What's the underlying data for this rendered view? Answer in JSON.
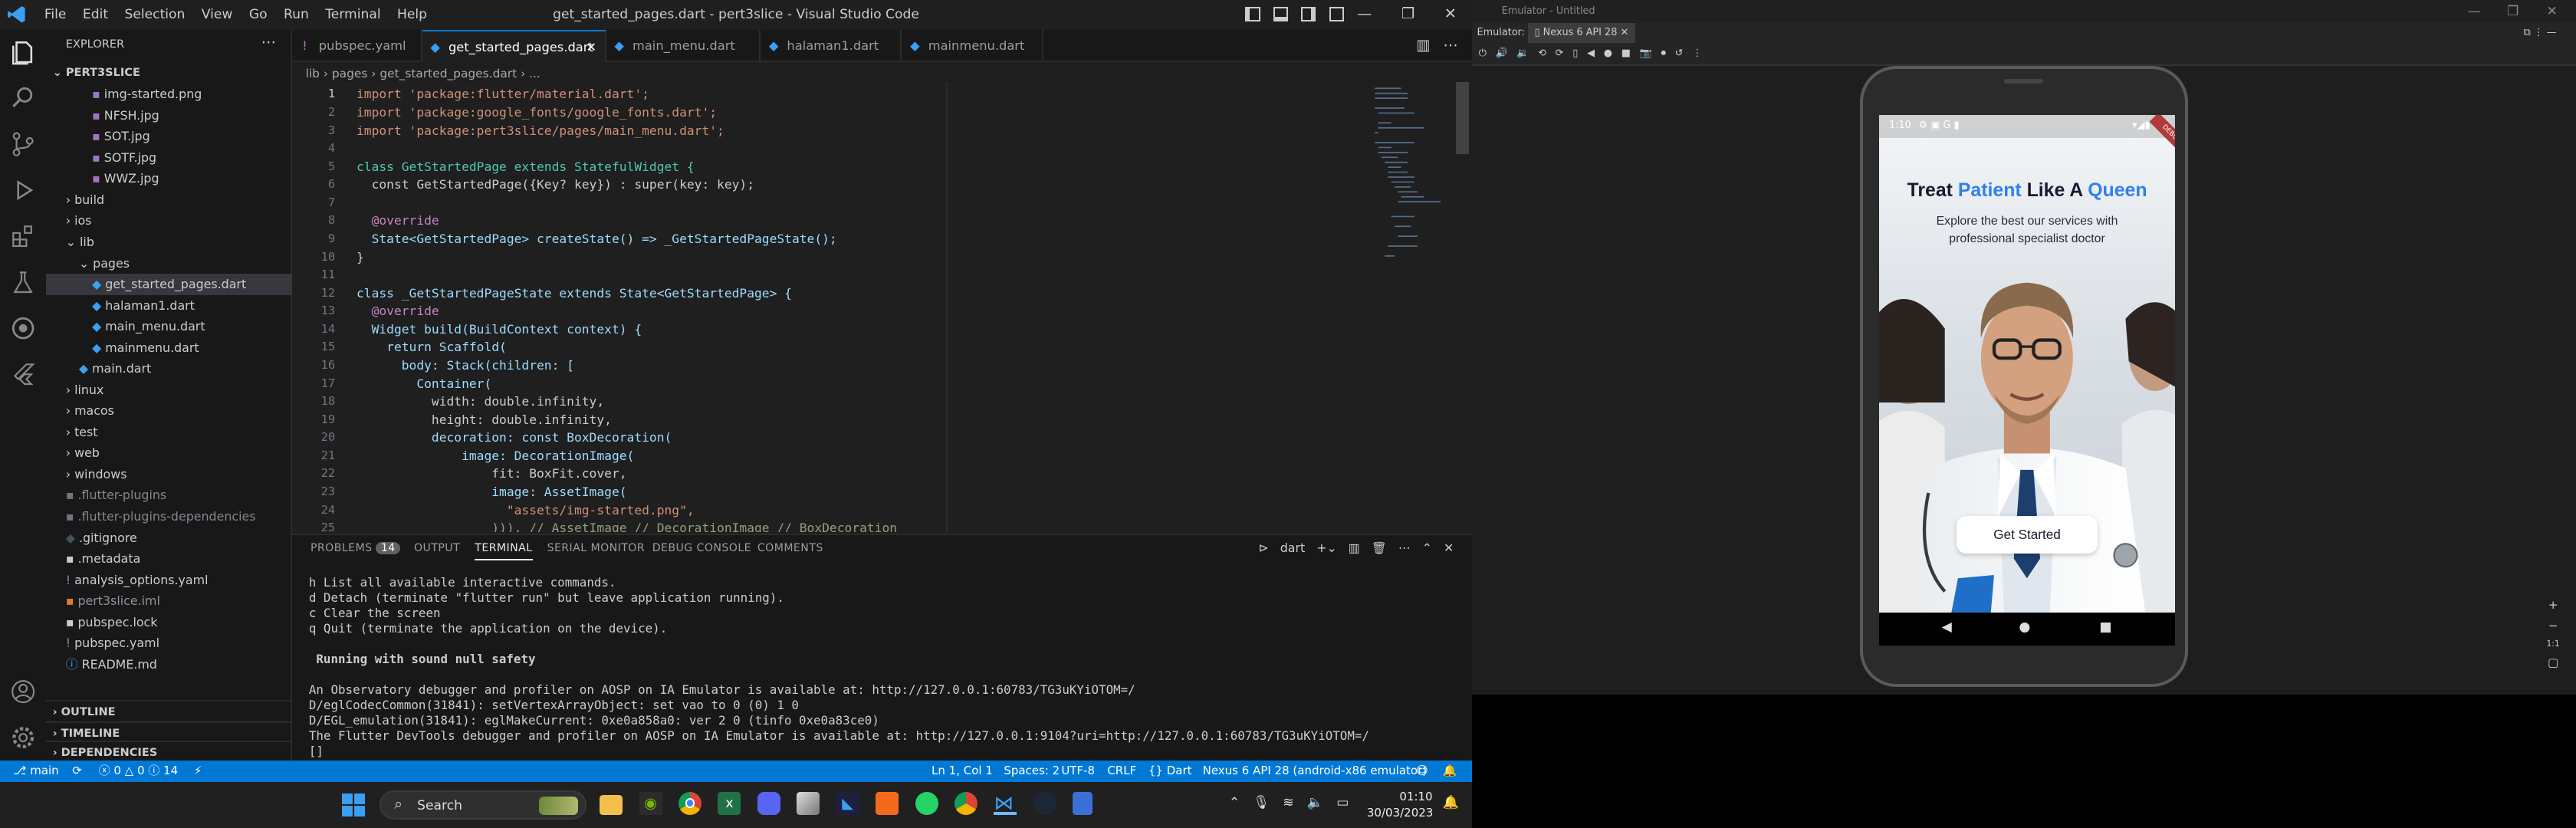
{
  "window": {
    "title": "get_started_pages.dart - pert3slice - Visual Studio Code"
  },
  "menu": [
    "File",
    "Edit",
    "Selection",
    "View",
    "Go",
    "Run",
    "Terminal",
    "Help"
  ],
  "explorer": {
    "header": "EXPLORER",
    "project": "PERT3SLICE",
    "items": [
      {
        "label": "img-started.png",
        "indent": 3,
        "kind": "png"
      },
      {
        "label": "NFSH.jpg",
        "indent": 3,
        "kind": "jpg"
      },
      {
        "label": "SOT.jpg",
        "indent": 3,
        "kind": "jpg"
      },
      {
        "label": "SOTF.jpg",
        "indent": 3,
        "kind": "jpg"
      },
      {
        "label": "WWZ.jpg",
        "indent": 3,
        "kind": "jpg"
      },
      {
        "label": "build",
        "indent": 1,
        "kind": "folder-closed"
      },
      {
        "label": "ios",
        "indent": 1,
        "kind": "folder-closed"
      },
      {
        "label": "lib",
        "indent": 1,
        "kind": "folder-open"
      },
      {
        "label": "pages",
        "indent": 2,
        "kind": "folder-open"
      },
      {
        "label": "get_started_pages.dart",
        "indent": 3,
        "kind": "dart",
        "selected": true
      },
      {
        "label": "halaman1.dart",
        "indent": 3,
        "kind": "dart"
      },
      {
        "label": "main_menu.dart",
        "indent": 3,
        "kind": "dart"
      },
      {
        "label": "mainmenu.dart",
        "indent": 3,
        "kind": "dart"
      },
      {
        "label": "main.dart",
        "indent": 2,
        "kind": "dart"
      },
      {
        "label": "linux",
        "indent": 1,
        "kind": "folder-closed"
      },
      {
        "label": "macos",
        "indent": 1,
        "kind": "folder-closed"
      },
      {
        "label": "test",
        "indent": 1,
        "kind": "folder-closed"
      },
      {
        "label": "web",
        "indent": 1,
        "kind": "folder-closed"
      },
      {
        "label": "windows",
        "indent": 1,
        "kind": "folder-closed"
      },
      {
        "label": ".flutter-plugins",
        "indent": 1,
        "kind": "dim"
      },
      {
        "label": ".flutter-plugins-dependencies",
        "indent": 1,
        "kind": "dim"
      },
      {
        "label": ".gitignore",
        "indent": 1,
        "kind": "git"
      },
      {
        "label": ".metadata",
        "indent": 1,
        "kind": "meta"
      },
      {
        "label": "analysis_options.yaml",
        "indent": 1,
        "kind": "yaml"
      },
      {
        "label": "pert3slice.iml",
        "indent": 1,
        "kind": "iml"
      },
      {
        "label": "pubspec.lock",
        "indent": 1,
        "kind": "lock"
      },
      {
        "label": "pubspec.yaml",
        "indent": 1,
        "kind": "yaml"
      },
      {
        "label": "README.md",
        "indent": 1,
        "kind": "md"
      }
    ],
    "sections": [
      "OUTLINE",
      "TIMELINE",
      "DEPENDENCIES"
    ]
  },
  "tabs": [
    {
      "label": "pubspec.yaml",
      "active": false
    },
    {
      "label": "get_started_pages.dart",
      "active": true
    },
    {
      "label": "main_menu.dart",
      "active": false
    },
    {
      "label": "halaman1.dart",
      "active": false
    },
    {
      "label": "mainmenu.dart",
      "active": false
    }
  ],
  "breadcrumb": "lib › pages › get_started_pages.dart › ...",
  "code": [
    "import 'package:flutter/material.dart';",
    "import 'package:google_fonts/google_fonts.dart';",
    "import 'package:pert3slice/pages/main_menu.dart';",
    "",
    "class GetStartedPage extends StatefulWidget {",
    "  const GetStartedPage({Key? key}) : super(key: key);",
    "",
    "  @override",
    "  State<GetStartedPage> createState() => _GetStartedPageState();",
    "}",
    "",
    "class _GetStartedPageState extends State<GetStartedPage> {",
    "  @override",
    "  Widget build(BuildContext context) {",
    "    return Scaffold(",
    "      body: Stack(children: [",
    "        Container(",
    "          width: double.infinity,",
    "          height: double.infinity,",
    "          decoration: const BoxDecoration(",
    "              image: DecorationImage(",
    "                  fit: BoxFit.cover,",
    "                  image: AssetImage(",
    "                    \"assets/img-started.png\",",
    "                  ))), // AssetImage // DecorationImage // BoxDecoration"
  ],
  "panel": {
    "tabs": [
      {
        "label": "PROBLEMS",
        "badge": "14"
      },
      {
        "label": "OUTPUT"
      },
      {
        "label": "TERMINAL",
        "active": true
      },
      {
        "label": "SERIAL MONITOR"
      },
      {
        "label": "DEBUG CONSOLE"
      },
      {
        "label": "COMMENTS"
      }
    ],
    "shell": "dart",
    "terminal": [
      "h List all available interactive commands.",
      "d Detach (terminate \"flutter run\" but leave application running).",
      "c Clear the screen",
      "q Quit (terminate the application on the device).",
      "",
      " Running with sound null safety",
      "",
      "An Observatory debugger and profiler on AOSP on IA Emulator is available at: http://127.0.0.1:60783/TG3uKYiOTOM=/",
      "D/eglCodecCommon(31841): setVertexArrayObject: set vao to 0 (0) 1 0",
      "D/EGL_emulation(31841): eglMakeCurrent: 0xe0a858a0: ver 2 0 (tinfo 0xe0a83ce0)",
      "The Flutter DevTools debugger and profiler on AOSP on IA Emulator is available at: http://127.0.0.1:9104?uri=http://127.0.0.1:60783/TG3uKYiOTOM=/",
      "[]"
    ]
  },
  "status": {
    "branch": "main",
    "problems": "0 △ 0 ⓘ 14",
    "position": "Ln 1, Col 1",
    "spaces": "Spaces: 2",
    "encoding": "UTF-8",
    "eol": "CRLF",
    "language": "{} Dart",
    "device": "Nexus 6 API 28 (android-x86 emulator)"
  },
  "emulator": {
    "window_title": "Emulator - Untitled",
    "label": "Emulator:",
    "device_tab": "Nexus 6 API 28",
    "phone": {
      "time": "1:10",
      "heading_a": "Treat ",
      "heading_b": "Patient",
      "heading_c": " Like A ",
      "heading_d": "Queen",
      "subtitle": "Explore the best our services with professional specialist doctor",
      "button": "Get Started",
      "debug_banner": "DEBUG"
    },
    "zoom_labels": [
      "+",
      "−",
      "1:1"
    ]
  },
  "taskbar": {
    "search_placeholder": "Search",
    "time": "01:10",
    "date": "30/03/2023"
  },
  "colors": {
    "accent": "#0078d4",
    "patient_blue": "#2f80ed",
    "status_bg": "#0078d4"
  }
}
